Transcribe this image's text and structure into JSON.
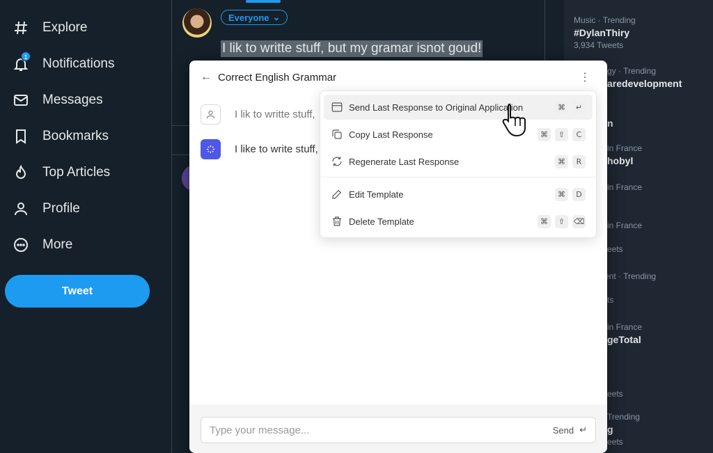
{
  "nav": {
    "items": [
      {
        "label": "Explore",
        "icon": "hashtag-icon"
      },
      {
        "label": "Notifications",
        "icon": "bell-icon",
        "badge": "1"
      },
      {
        "label": "Messages",
        "icon": "envelope-icon"
      },
      {
        "label": "Bookmarks",
        "icon": "bookmark-icon"
      },
      {
        "label": "Top Articles",
        "icon": "flame-icon"
      },
      {
        "label": "Profile",
        "icon": "person-icon"
      },
      {
        "label": "More",
        "icon": "more-circle-icon"
      }
    ],
    "tweet_button": "Tweet"
  },
  "compose": {
    "audience": "Everyone",
    "tweet_text": "I lik to writte stuff, but my gramar isnot goud!"
  },
  "trends": [
    {
      "meta": "Music · Trending",
      "name": "#DylanThiry",
      "count": "3,934 Tweets"
    },
    {
      "meta": "gy · Trending",
      "name": "aredevelopment",
      "count": ""
    },
    {
      "meta": "",
      "name": "n",
      "count": ""
    },
    {
      "meta": "in France",
      "name": "hobyl",
      "count": ""
    },
    {
      "meta": "in France",
      "name": "",
      "count": ""
    },
    {
      "meta": "in France",
      "name": "",
      "count": "eets"
    },
    {
      "meta": "ment · Trending",
      "name": "",
      "count": "ts"
    },
    {
      "meta": "in France",
      "name": "geTotal",
      "count": ""
    },
    {
      "meta": "",
      "name": "",
      "count": "eets"
    },
    {
      "meta": "Trending",
      "name": "g",
      "count": "eets"
    }
  ],
  "panel": {
    "title": "Correct English Grammar",
    "messages": [
      {
        "role": "user",
        "text": "I lik to writte stuff,"
      },
      {
        "role": "assistant",
        "text": "I like to write stuff,"
      }
    ],
    "input_placeholder": "Type your message...",
    "send_label": "Send"
  },
  "menu": {
    "items": [
      {
        "label": "Send Last Response to Original Application",
        "icon": "window-icon",
        "keys": [
          "⌘",
          "↵"
        ]
      },
      {
        "label": "Copy Last Response",
        "icon": "copy-icon",
        "keys": [
          "⌘",
          "⇧",
          "C"
        ]
      },
      {
        "label": "Regenerate Last Response",
        "icon": "refresh-icon",
        "keys": [
          "⌘",
          "R"
        ]
      },
      {
        "label": "Edit Template",
        "icon": "pencil-icon",
        "keys": [
          "⌘",
          "D"
        ]
      },
      {
        "label": "Delete Template",
        "icon": "trash-icon",
        "keys": [
          "⌘",
          "⇧",
          "⌫"
        ]
      }
    ]
  },
  "colors": {
    "background": "#15202b",
    "accent": "#1d9bf0",
    "ai_icon": "#4f57e6"
  }
}
